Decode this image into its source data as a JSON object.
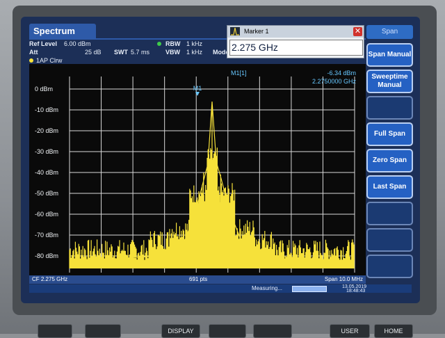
{
  "header": {
    "tab_label": "Spectrum",
    "ref_level_label": "Ref Level",
    "ref_level_value": "6.00 dBm",
    "att_label": "Att",
    "att_value": "25 dB",
    "swt_label": "SWT",
    "swt_value": "5.7 ms",
    "rbw_label": "RBW",
    "rbw_value": "1 kHz",
    "vbw_label": "VBW",
    "vbw_value": "1 kHz",
    "mode_label": "Mode"
  },
  "marker_dialog": {
    "title": "Marker 1",
    "value": "2.275 GHz",
    "close_symbol": "✕"
  },
  "softkeys": {
    "title": "Span",
    "items": [
      "Span Manual",
      "Sweeptime Manual",
      "",
      "Full Span",
      "Zero Span",
      "Last Span",
      "",
      "",
      ""
    ]
  },
  "trace": {
    "label": "1AP Clrw",
    "marker_readout_name": "M1[1]",
    "marker_level": "-6.34 dBm",
    "marker_freq": "2.2750000 GHz",
    "marker_tag": "M1"
  },
  "y_axis": {
    "labels": [
      "0 dBm",
      "-10 dBm",
      "-20 dBm",
      "-30 dBm",
      "-40 dBm",
      "-50 dBm",
      "-60 dBm",
      "-70 dBm",
      "-80 dBm"
    ]
  },
  "bottom": {
    "cf_label": "CF 2.275 GHz",
    "pts_label": "691 pts",
    "span_label": "Span 10.0 MHz"
  },
  "status": {
    "measuring": "Measuring...",
    "date": "13.05.2019",
    "time": "18:48:43"
  },
  "hardware_buttons": [
    "",
    "",
    "DISPLAY",
    "",
    "",
    "USER",
    "HOME"
  ],
  "chart_data": {
    "type": "line",
    "title": "",
    "xlabel": "",
    "ylabel": "",
    "x_center": "2.275 GHz",
    "x_span": "10.0 MHz",
    "ylim": [
      -88,
      6
    ],
    "y_ticks": [
      0,
      -10,
      -20,
      -30,
      -40,
      -50,
      -60,
      -70,
      -80
    ],
    "grid": true,
    "series": [
      {
        "color": "#f6e13a",
        "x": [
          -5,
          -4,
          -3,
          -2,
          -1.5,
          -1,
          -0.6,
          -0.3,
          -0.15,
          0,
          0.15,
          0.3,
          0.6,
          1,
          1.5,
          2,
          3,
          4,
          5
        ],
        "values": [
          -82,
          -82,
          -81,
          -80,
          -78,
          -74,
          -60,
          -44,
          -36,
          -6,
          -35,
          -42,
          -58,
          -72,
          -77,
          -80,
          -81,
          -82,
          -82
        ]
      }
    ]
  }
}
